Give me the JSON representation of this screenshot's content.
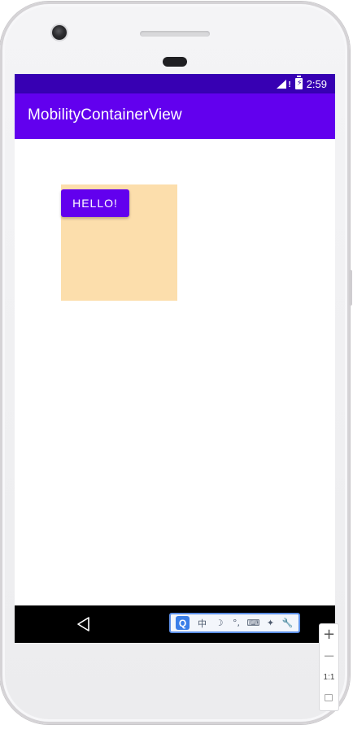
{
  "status_bar": {
    "time": "2:59",
    "background_color": "#3700b3",
    "icons": [
      "signal-icon",
      "battery-icon"
    ]
  },
  "app_bar": {
    "title": "MobilityContainerView",
    "background_color": "#6200ee"
  },
  "content": {
    "container_color": "#fcdeac",
    "hello_button_label": "HELLO!",
    "hello_button_color": "#6200ee"
  },
  "nav_bar": {
    "icons": [
      "back-icon"
    ]
  },
  "ime_toolbar": {
    "q_label": "Q",
    "items": [
      "中",
      "☽",
      "°,",
      "⌨",
      "✦",
      "🔧"
    ]
  },
  "zoom_controls": {
    "plus_label": "+",
    "minus_label": "−",
    "ratio_label": "1:1"
  }
}
